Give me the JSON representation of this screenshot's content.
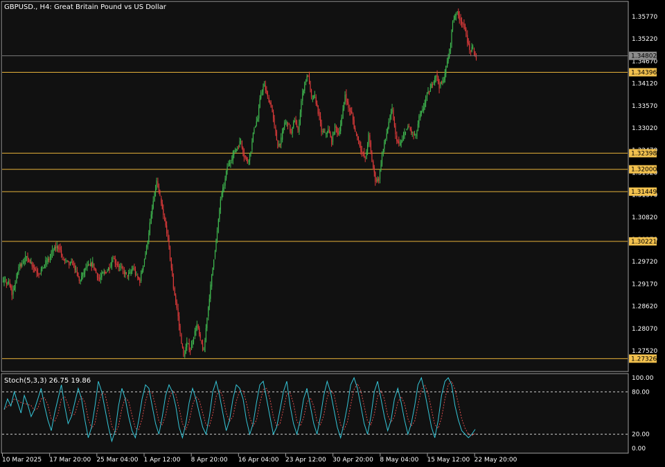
{
  "window": {
    "title": "GBPUSD., H4:  Great Britain Pound vs US Dollar"
  },
  "colors": {
    "background": "#000000",
    "plot_background": "#111111",
    "frame": "#a0a0a0",
    "text": "#ffffff",
    "bull": "#3fb950",
    "bear": "#e03b3b",
    "level_line": "#e8b23a",
    "level_badge": "#f2c14e",
    "current_price_badge": "#8c8c8c",
    "stoch_main": "#35c6d8",
    "stoch_signal": "#d94b4b",
    "stoch_level": "#cfcfcf"
  },
  "price_axis": {
    "labels": [
      "1.35770",
      "1.35220",
      "1.34670",
      "1.34120",
      "1.33570",
      "1.33020",
      "1.32470",
      "1.31920",
      "1.31370",
      "1.30820",
      "1.30270",
      "1.29720",
      "1.29170",
      "1.28620",
      "1.28070",
      "1.27520"
    ]
  },
  "horizontal_levels": [
    {
      "label": "1.34396",
      "price": 1.34396
    },
    {
      "label": "1.32398",
      "price": 1.32398
    },
    {
      "label": "1.32000",
      "price": 1.32
    },
    {
      "label": "1.31449",
      "price": 1.31449
    },
    {
      "label": "1.30221",
      "price": 1.30221
    },
    {
      "label": "1.27326",
      "price": 1.27326
    }
  ],
  "current_price": {
    "label": "1.34802",
    "price": 1.34802
  },
  "indicator": {
    "title": "Stoch(5,3,3) 26.75 19.86",
    "axis_labels": [
      "100.00",
      "80.00",
      "20.00",
      "0.00"
    ],
    "levels": [
      80,
      20
    ]
  },
  "time_axis": {
    "labels": [
      "10 Mar 2025",
      "17 Mar 20:00",
      "25 Mar 04:00",
      "1 Apr 12:00",
      "8 Apr 20:00",
      "16 Apr 04:00",
      "23 Apr 12:00",
      "30 Apr 20:00",
      "8 May 04:00",
      "15 May 12:00",
      "22 May 20:00"
    ]
  },
  "chart_data": {
    "type": "line",
    "symbol": "GBPUSD.",
    "timeframe": "H4",
    "x_ticks": [
      "10 Mar 2025",
      "17 Mar 20:00",
      "25 Mar 04:00",
      "1 Apr 12:00",
      "8 Apr 20:00",
      "16 Apr 04:00",
      "23 Apr 12:00",
      "30 Apr 20:00",
      "8 May 04:00",
      "15 May 12:00",
      "22 May 20:00"
    ],
    "ylim": [
      1.271,
      1.3598
    ],
    "series": [
      {
        "name": "GBPUSD.",
        "values": [
          [
            0,
            1.293
          ],
          [
            2,
            1.2895
          ],
          [
            4,
            1.2955
          ],
          [
            6,
            1.2985
          ],
          [
            8,
            1.296
          ],
          [
            10,
            1.294
          ],
          [
            12,
            1.2965
          ],
          [
            14,
            1.3
          ],
          [
            16,
            1.3005
          ],
          [
            18,
            1.297
          ],
          [
            20,
            1.296
          ],
          [
            22,
            1.293
          ],
          [
            24,
            1.295
          ],
          [
            26,
            1.2965
          ],
          [
            28,
            1.292
          ],
          [
            30,
            1.295
          ],
          [
            32,
            1.2975
          ],
          [
            34,
            1.2965
          ],
          [
            36,
            1.294
          ],
          [
            38,
            1.295
          ],
          [
            40,
            1.292
          ],
          [
            41,
            1.296
          ],
          [
            43,
            1.307
          ],
          [
            45,
            1.317
          ],
          [
            47,
            1.309
          ],
          [
            49,
            1.299
          ],
          [
            50,
            1.291
          ],
          [
            51,
            1.286
          ],
          [
            52,
            1.279
          ],
          [
            53,
            1.273
          ],
          [
            54,
            1.277
          ],
          [
            55,
            1.276
          ],
          [
            57,
            1.282
          ],
          [
            58,
            1.278
          ],
          [
            59,
            1.275
          ],
          [
            60,
            1.284
          ],
          [
            62,
            1.298
          ],
          [
            64,
            1.312
          ],
          [
            66,
            1.32
          ],
          [
            68,
            1.324
          ],
          [
            70,
            1.327
          ],
          [
            71,
            1.323
          ],
          [
            72,
            1.321
          ],
          [
            73,
            1.325
          ],
          [
            74,
            1.33
          ],
          [
            75,
            1.333
          ],
          [
            76,
            1.339
          ],
          [
            77,
            1.341
          ],
          [
            78,
            1.338
          ],
          [
            79,
            1.336
          ],
          [
            80,
            1.33
          ],
          [
            81,
            1.325
          ],
          [
            82,
            1.328
          ],
          [
            83,
            1.331
          ],
          [
            84,
            1.332
          ],
          [
            85,
            1.329
          ],
          [
            86,
            1.333
          ],
          [
            87,
            1.33
          ],
          [
            88,
            1.336
          ],
          [
            89,
            1.342
          ],
          [
            90,
            1.343
          ],
          [
            91,
            1.338
          ],
          [
            92,
            1.338
          ],
          [
            93,
            1.334
          ],
          [
            94,
            1.33
          ],
          [
            95,
            1.328
          ],
          [
            96,
            1.329
          ],
          [
            97,
            1.326
          ],
          [
            98,
            1.33
          ],
          [
            99,
            1.328
          ],
          [
            100,
            1.332
          ],
          [
            101,
            1.339
          ],
          [
            102,
            1.336
          ],
          [
            103,
            1.334
          ],
          [
            104,
            1.33
          ],
          [
            105,
            1.328
          ],
          [
            106,
            1.324
          ],
          [
            107,
            1.323
          ],
          [
            108,
            1.328
          ],
          [
            109,
            1.322
          ],
          [
            110,
            1.317
          ],
          [
            111,
            1.318
          ],
          [
            112,
            1.323
          ],
          [
            113,
            1.328
          ],
          [
            114,
            1.332
          ],
          [
            115,
            1.334
          ],
          [
            116,
            1.329
          ],
          [
            117,
            1.326
          ],
          [
            118,
            1.328
          ],
          [
            119,
            1.329
          ],
          [
            120,
            1.33
          ],
          [
            121,
            1.328
          ],
          [
            122,
            1.329
          ],
          [
            123,
            1.332
          ],
          [
            124,
            1.335
          ],
          [
            125,
            1.337
          ],
          [
            126,
            1.339
          ],
          [
            127,
            1.341
          ],
          [
            128,
            1.344
          ],
          [
            129,
            1.341
          ],
          [
            130,
            1.342
          ],
          [
            131,
            1.345
          ],
          [
            132,
            1.35
          ],
          [
            133,
            1.356
          ],
          [
            134,
            1.3585
          ],
          [
            135,
            1.357
          ],
          [
            136,
            1.356
          ],
          [
            137,
            1.354
          ],
          [
            138,
            1.35
          ],
          [
            139,
            1.349
          ],
          [
            140,
            1.348
          ]
        ]
      }
    ],
    "indicator_series": [
      {
        "name": "Stoch(5,3,3)",
        "ylim": [
          0,
          100
        ],
        "values": [
          55,
          70,
          60,
          80,
          65,
          50,
          75,
          62,
          45,
          55,
          70,
          85,
          60,
          40,
          25,
          50,
          70,
          90,
          60,
          35,
          45,
          65,
          85,
          70,
          40,
          15,
          30,
          60,
          95,
          80,
          55,
          30,
          10,
          25,
          60,
          85,
          70,
          45,
          25,
          15,
          40,
          70,
          90,
          85,
          60,
          35,
          20,
          45,
          75,
          90,
          80,
          60,
          30,
          15,
          35,
          65,
          85,
          70,
          50,
          30,
          20,
          45,
          80,
          95,
          75,
          50,
          25,
          40,
          70,
          90,
          85,
          70,
          40,
          20,
          35,
          65,
          90,
          95,
          70,
          45,
          20,
          30,
          55,
          80,
          95,
          60,
          35,
          20,
          40,
          70,
          85,
          60,
          35,
          20,
          45,
          75,
          95,
          80,
          55,
          30,
          15,
          35,
          60,
          90,
          100,
          85,
          60,
          35,
          20,
          45,
          80,
          95,
          70,
          45,
          25,
          40,
          70,
          85,
          65,
          40,
          20,
          35,
          60,
          90,
          100,
          80,
          55,
          30,
          15,
          40,
          75,
          95,
          100,
          90,
          60,
          40,
          25,
          20,
          15,
          20,
          27
        ]
      },
      {
        "name": "Signal",
        "values": "smoothed_main"
      }
    ]
  }
}
